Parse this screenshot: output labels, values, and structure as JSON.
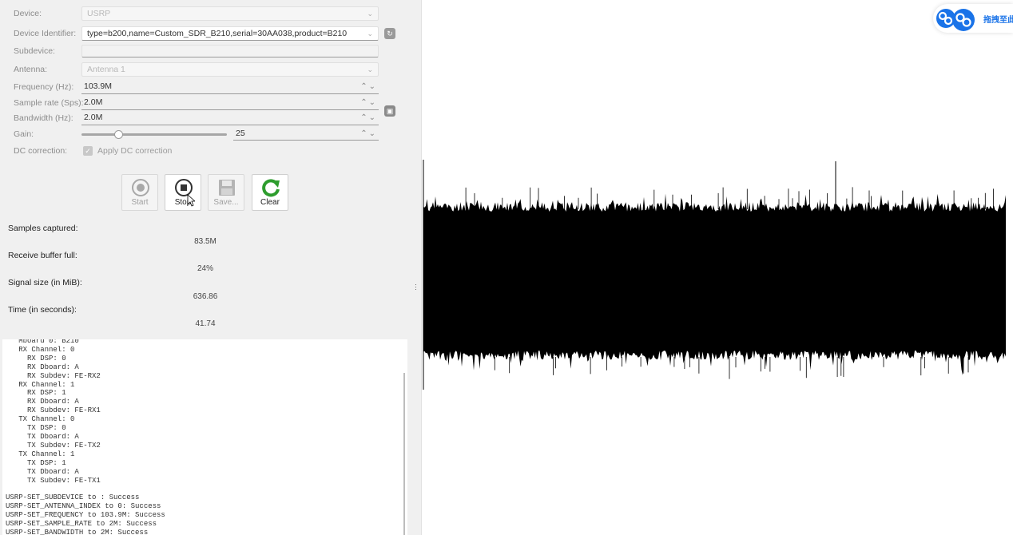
{
  "form": {
    "device": {
      "label": "Device:",
      "value": "USRP"
    },
    "device_identifier": {
      "label": "Device Identifier:",
      "value": "type=b200,name=Custom_SDR_B210,serial=30AA038,product=B210"
    },
    "subdevice": {
      "label": "Subdevice:",
      "value": ""
    },
    "antenna": {
      "label": "Antenna:",
      "value": "Antenna 1"
    },
    "frequency": {
      "label": "Frequency (Hz):",
      "value": "103.9M"
    },
    "sample_rate": {
      "label": "Sample rate (Sps):",
      "value": "2.0M"
    },
    "bandwidth": {
      "label": "Bandwidth (Hz):",
      "value": "2.0M"
    },
    "gain": {
      "label": "Gain:",
      "value": "25",
      "level": 0.25
    },
    "dc_correction": {
      "label": "DC correction:",
      "checkbox_label": "Apply DC correction",
      "checked": true
    }
  },
  "toolbar": {
    "start_label": "Start",
    "stop_label": "Stop",
    "save_label": "Save...",
    "clear_label": "Clear"
  },
  "stats": {
    "samples_captured": {
      "label": "Samples captured:",
      "value": "83.5M"
    },
    "buffer_full": {
      "label": "Receive buffer full:",
      "value": "24%"
    },
    "signal_size": {
      "label": "Signal size (in MiB):",
      "value": "636.86"
    },
    "time": {
      "label": "Time (in seconds):",
      "value": "41.74"
    }
  },
  "log": {
    "text": "   Mboard 0: B210\n   RX Channel: 0\n     RX DSP: 0\n     RX Dboard: A\n     RX Subdev: FE-RX2\n   RX Channel: 1\n     RX DSP: 1\n     RX Dboard: A\n     RX Subdev: FE-RX1\n   TX Channel: 0\n     TX DSP: 0\n     TX Dboard: A\n     TX Subdev: FE-TX2\n   TX Channel: 1\n     TX DSP: 1\n     TX Dboard: A\n     TX Subdev: FE-TX1\n\nUSRP-SET_SUBDEVICE to : Success\nUSRP-SET_ANTENNA_INDEX to 0: Success\nUSRP-SET_FREQUENCY to 103.9M: Success\nUSRP-SET_SAMPLE_RATE to 2M: Success\nUSRP-SET_BANDWIDTH to 2M: Success"
  },
  "overlay": {
    "text": "拖拽至此"
  },
  "colors": {
    "panel_bg": "#f0f0f0",
    "waveform": "#000000",
    "clear_icon": "#2e9d2e",
    "overlay_blue": "#1a73e8"
  }
}
